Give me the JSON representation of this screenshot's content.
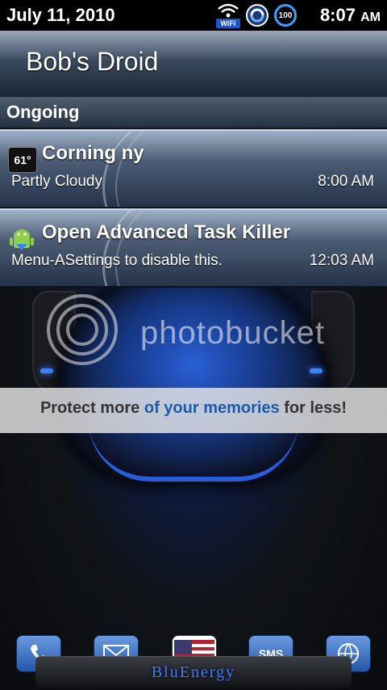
{
  "statusbar": {
    "date": "July 11, 2010",
    "wifi_label": "WiFi",
    "battery_level": "100",
    "time": "8:07",
    "am_pm": "AM"
  },
  "shade": {
    "header_title": "Bob's Droid",
    "section_label": "Ongoing",
    "notifications": [
      {
        "icon": "weather-icon",
        "badge": "61°",
        "title": "Corning  ny",
        "subtitle": "Partly Cloudy",
        "time": "8:00 AM"
      },
      {
        "icon": "android-robot-icon",
        "title": "Open Advanced Task Killer",
        "subtitle": "Menu-ASettings to disable this.",
        "time": "12:03 AM"
      }
    ]
  },
  "watermark": {
    "brand": "photobucket",
    "tagline_pre": "Protect more ",
    "tagline_hl": "of your memories",
    "tagline_post": " for less!"
  },
  "dock": {
    "icons": [
      "phone-icon",
      "mail-icon",
      "flag-icon",
      "sms-icon",
      "browser-icon"
    ],
    "sms_label": "SMS",
    "brand": "BluEnergy"
  },
  "colors": {
    "accent": "#3b82ff",
    "statusbar_bg": "#000000"
  }
}
